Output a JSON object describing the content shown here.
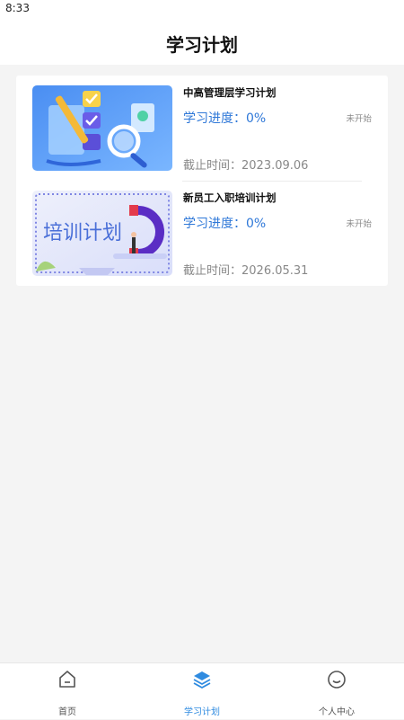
{
  "status_bar": {
    "time": "8:33"
  },
  "header": {
    "title": "学习计划"
  },
  "plans": [
    {
      "name": "中高管理层学习计划",
      "progress": "学习进度：0%",
      "status": "未开始",
      "deadline": "截止时间：2023.09.06",
      "thumb_icon": "checklist-magnifier-illustration"
    },
    {
      "name": "新员工入职培训计划",
      "progress": "学习进度：0%",
      "status": "未开始",
      "deadline": "截止时间：2026.05.31",
      "thumb_icon": "magnet-training-illustration",
      "thumb_text": "培训计划"
    }
  ],
  "tabbar": {
    "items": [
      {
        "label": "首页",
        "icon": "home-icon",
        "active": false
      },
      {
        "label": "学习计划",
        "icon": "layers-icon",
        "active": true
      },
      {
        "label": "个人中心",
        "icon": "smile-icon",
        "active": false
      }
    ]
  },
  "colors": {
    "accent": "#2f8be0",
    "progress_text": "#2f78d8",
    "background": "#f4f4f4"
  }
}
